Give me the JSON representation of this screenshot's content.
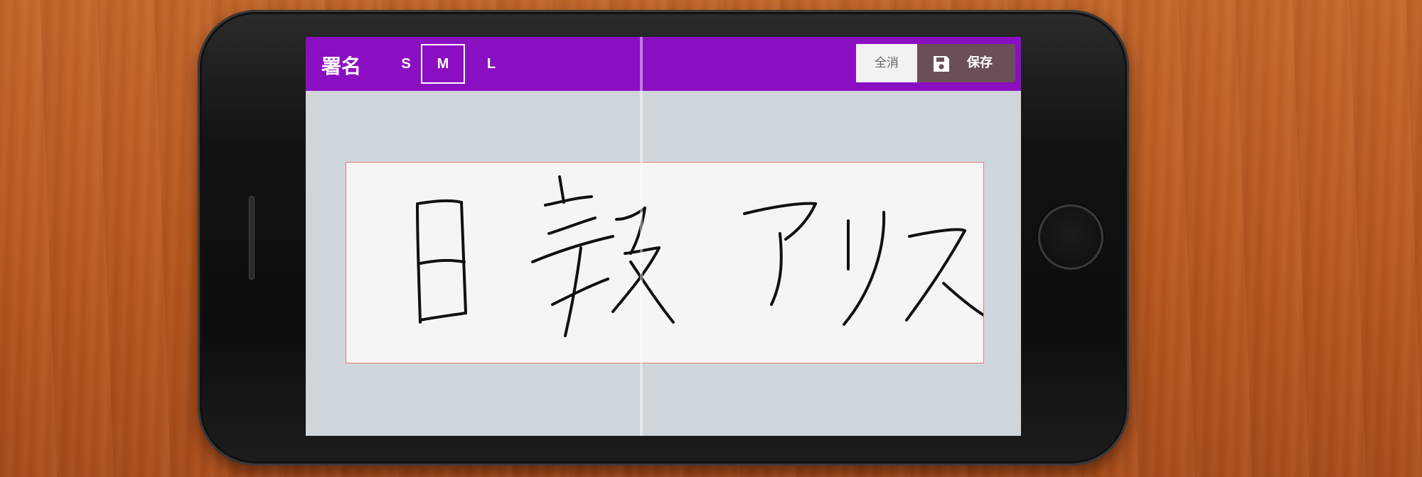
{
  "header": {
    "title": "署名"
  },
  "pen_sizes": {
    "options": [
      "S",
      "M",
      "L"
    ],
    "selected": "M"
  },
  "actions": {
    "clear_label": "全消",
    "save_label": "保存"
  },
  "signature": {
    "handwritten_text": "日報アリス"
  },
  "colors": {
    "toolbar": "#8b0fc2",
    "save_button": "#6b4f57",
    "pad_border": "#e87a7a",
    "canvas_background": "#cfd6db"
  },
  "icons": {
    "save": "floppy-disk-icon"
  }
}
